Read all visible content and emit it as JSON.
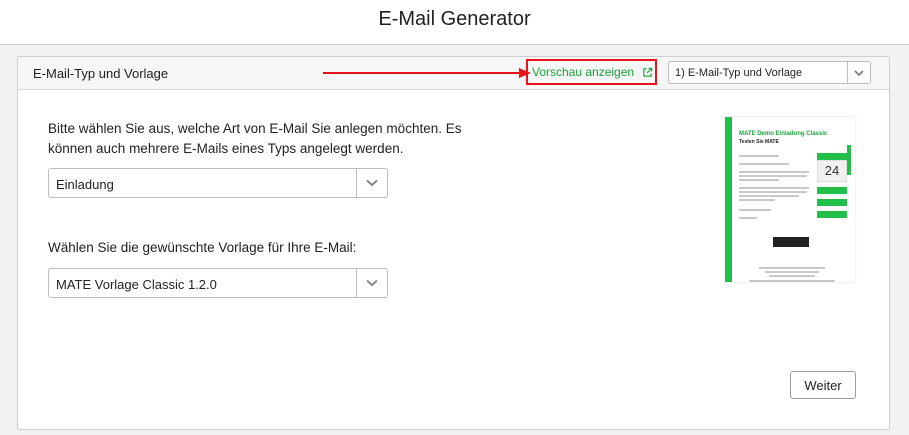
{
  "header": {
    "title": "E-Mail Generator"
  },
  "panel": {
    "title": "E-Mail-Typ und Vorlage",
    "preview_link": "Vorschau anzeigen",
    "step_select": {
      "value": "1) E-Mail-Typ und Vorlage"
    }
  },
  "main": {
    "instruction_type": "Bitte wählen Sie aus, welche Art von E-Mail Sie anlegen möchten. Es können auch mehrere E-Mails eines Typs angelegt werden.",
    "type_select": {
      "value": "Einladung"
    },
    "instruction_template": "Wählen Sie die gewünschte Vorlage für Ihre E-Mail:",
    "template_select": {
      "value": "MATE Vorlage Classic 1.2.0"
    },
    "next_button": "Weiter"
  },
  "thumbnail": {
    "title": "MATE Demo Einladung Classic",
    "subtitle": "Testen Sie MATE",
    "date_day": "24"
  },
  "colors": {
    "accent_green": "#1aa33a",
    "highlight_red": "#e8141b"
  }
}
